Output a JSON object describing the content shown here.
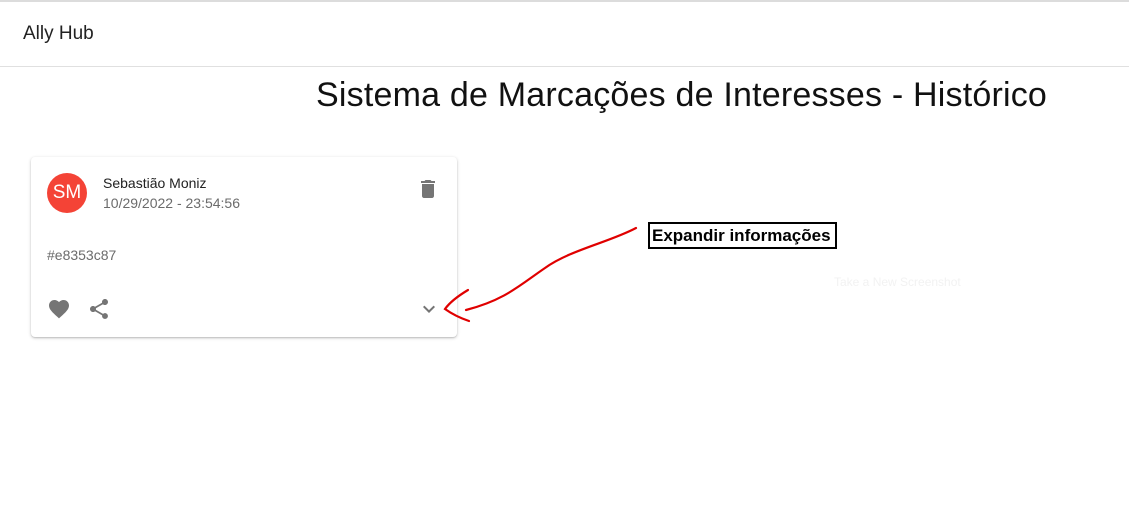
{
  "app": {
    "title": "Ally Hub"
  },
  "page": {
    "title": "Sistema de Marcações de Interesses - Histórico"
  },
  "card": {
    "avatar_initials": "SM",
    "author": "Sebastião Moniz",
    "timestamp": "10/29/2022 - 23:54:56",
    "hash": "#e8353c87",
    "icons": {
      "delete": "trash-icon",
      "favorite": "heart-icon",
      "share": "share-icon",
      "expand": "chevron-down-icon"
    }
  },
  "annotation": {
    "label": "Expandir informações"
  },
  "faint_button": {
    "label": "Take a New Screenshot"
  },
  "colors": {
    "avatar": "#f44336",
    "icon": "#757575",
    "arrow": "#e00000"
  }
}
